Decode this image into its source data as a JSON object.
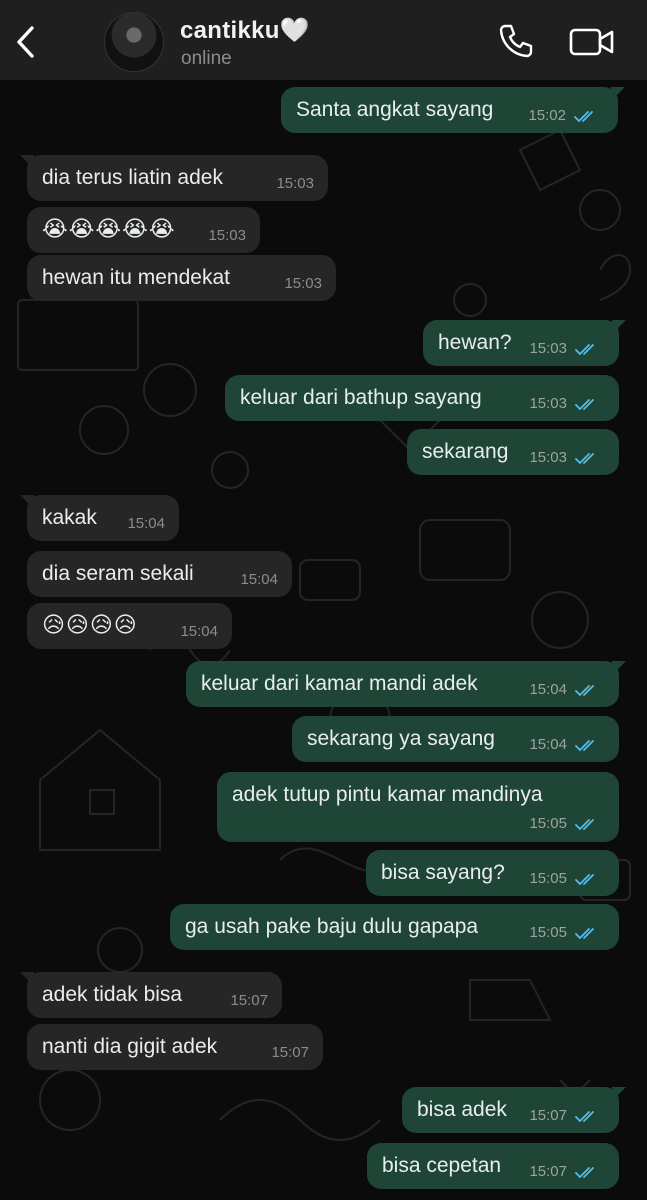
{
  "header": {
    "contact_name": "cantikku🤍",
    "status": "online",
    "back_icon": "chevron-left-icon",
    "call_icon": "phone-icon",
    "video_icon": "video-camera-icon"
  },
  "colors": {
    "background": "#0b0b0b",
    "header": "#1f1f1f",
    "incoming_bubble": "#262626",
    "outgoing_bubble": "#1e4535",
    "read_ticks": "#53bdeb"
  },
  "messages": [
    {
      "dir": "out",
      "text": "Santa angkat sayang",
      "time": "15:02"
    },
    {
      "dir": "in",
      "text": "dia terus liatin adek",
      "time": "15:03"
    },
    {
      "dir": "in",
      "text": "😭😭😭😭😭",
      "time": "15:03"
    },
    {
      "dir": "in",
      "text": "hewan itu mendekat",
      "time": "15:03"
    },
    {
      "dir": "out",
      "text": "hewan?",
      "time": "15:03"
    },
    {
      "dir": "out",
      "text": "keluar dari bathup sayang",
      "time": "15:03"
    },
    {
      "dir": "out",
      "text": "sekarang",
      "time": "15:03"
    },
    {
      "dir": "in",
      "text": "kakak",
      "time": "15:04"
    },
    {
      "dir": "in",
      "text": "dia seram sekali",
      "time": "15:04"
    },
    {
      "dir": "in",
      "text": "😥😥😥😥",
      "time": "15:04"
    },
    {
      "dir": "out",
      "text": "keluar dari kamar mandi adek",
      "time": "15:04"
    },
    {
      "dir": "out",
      "text": "sekarang ya sayang",
      "time": "15:04"
    },
    {
      "dir": "out",
      "text": "adek tutup pintu kamar mandinya",
      "time": "15:05"
    },
    {
      "dir": "out",
      "text": "bisa sayang?",
      "time": "15:05"
    },
    {
      "dir": "out",
      "text": "ga usah pake baju dulu gapapa",
      "time": "15:05"
    },
    {
      "dir": "in",
      "text": "adek tidak bisa",
      "time": "15:07"
    },
    {
      "dir": "in",
      "text": "nanti dia gigit adek",
      "time": "15:07"
    },
    {
      "dir": "out",
      "text": "bisa adek",
      "time": "15:07"
    },
    {
      "dir": "out",
      "text": "bisa cepetan",
      "time": "15:07"
    }
  ]
}
